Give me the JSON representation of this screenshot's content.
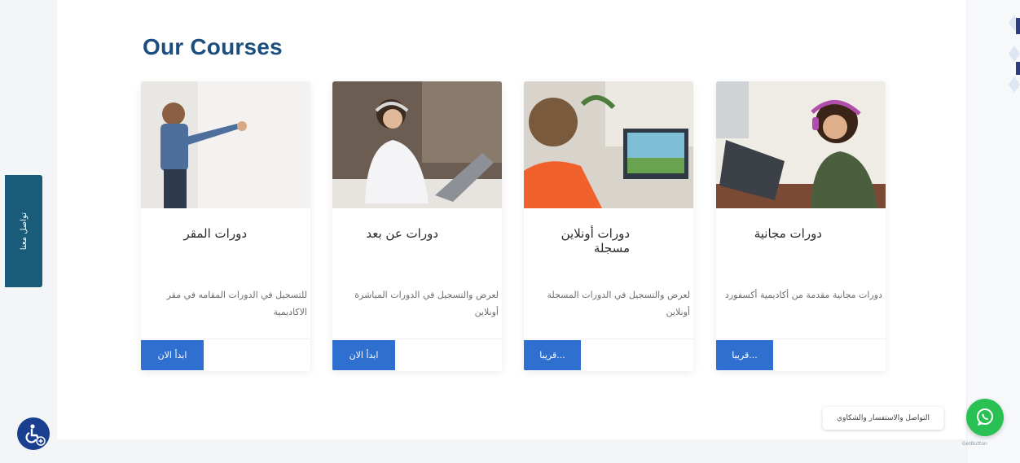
{
  "section": {
    "title": "Our Courses"
  },
  "cards": [
    {
      "title": "دورات المقر",
      "description": "للتسجيل في الدورات المقامه في مقر الاكاديمية",
      "button": "ابدأ الان",
      "image": "teacher-whiteboard"
    },
    {
      "title": "دورات عن بعد",
      "description": "لعرض والتسجيل في الدورات المباشرة أونلاين",
      "button": "ابدأ الان",
      "image": "woman-headset-laptop"
    },
    {
      "title": "دورات أونلاين مسجلة",
      "description": "لعرض والتسجيل في الدورات المسجلة أونلاين",
      "button": "...قريبا",
      "image": "boy-computer"
    },
    {
      "title": "دورات مجانية",
      "description": "دورات مجانية مقدمة من أكاديمية أكسفورد",
      "button": "...قريبا",
      "image": "girl-headphones-laptop"
    }
  ],
  "contact_tab": {
    "label": "تواصل معنا"
  },
  "chat": {
    "bubble_text": "التواصل والاستفسار والشكاوي",
    "brand": "GetButton"
  },
  "icons": {
    "accessibility": "accessibility-icon",
    "whatsapp": "whatsapp-icon"
  },
  "colors": {
    "accent": "#2f6fcf",
    "title": "#1b4d7e",
    "contact_tab": "#1a5b79",
    "whatsapp": "#29c153",
    "accessibility": "#1b3f8f"
  }
}
